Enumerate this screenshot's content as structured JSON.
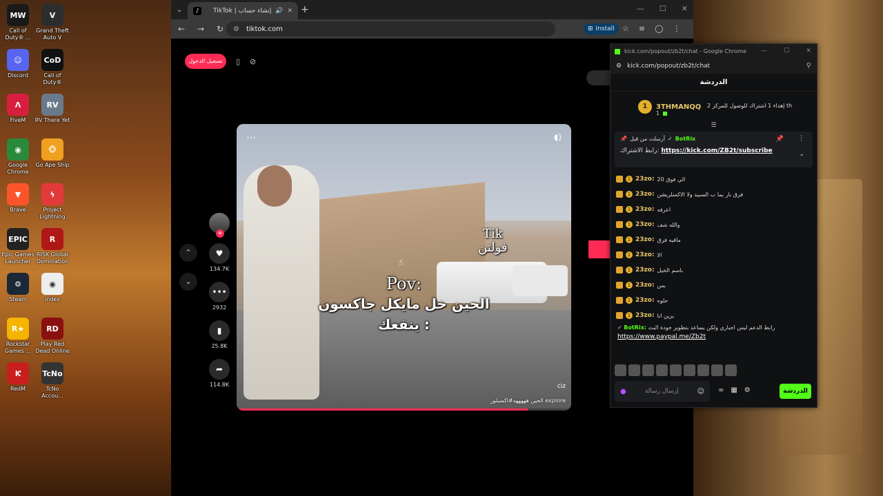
{
  "desktop": {
    "icons": [
      {
        "label": "Call of Duty® ...",
        "icon": "mw-icon",
        "color": "#1a1a1a",
        "glyph": "MW"
      },
      {
        "label": "Grand Theft Auto V",
        "icon": "gta-icon",
        "color": "#2d2d2d",
        "glyph": "V"
      },
      {
        "label": "Discord",
        "icon": "discord-icon",
        "color": "#5865f2",
        "glyph": "☺"
      },
      {
        "label": "Call of Duty®",
        "icon": "cod-icon",
        "color": "#111111",
        "glyph": "CoD"
      },
      {
        "label": "FiveM",
        "icon": "fivem-icon",
        "color": "#d81e3f",
        "glyph": "Λ"
      },
      {
        "label": "RV There Yet",
        "icon": "rv-icon",
        "color": "#6b7a8a",
        "glyph": "RV"
      },
      {
        "label": "Google Chrome",
        "icon": "chrome-icon",
        "color": "#2a8a3a",
        "glyph": "◉"
      },
      {
        "label": "Go Ape Ship",
        "icon": "goape-icon",
        "color": "#f0a020",
        "glyph": "🐵"
      },
      {
        "label": "Brave",
        "icon": "brave-icon",
        "color": "#fb542b",
        "glyph": "▼"
      },
      {
        "label": "Project Lightning",
        "icon": "lightning-icon",
        "color": "#e23a3a",
        "glyph": "ϟ"
      },
      {
        "label": "Epic Games Launcher",
        "icon": "epic-icon",
        "color": "#222222",
        "glyph": "EPIC"
      },
      {
        "label": "RISK Global Domination",
        "icon": "risk-icon",
        "color": "#b01818",
        "glyph": "R"
      },
      {
        "label": "Steam",
        "icon": "steam-icon",
        "color": "#1b2838",
        "glyph": "⚙"
      },
      {
        "label": "index",
        "icon": "index-chrome-icon",
        "color": "#eeeeee",
        "glyph": "◉"
      },
      {
        "label": "Rockstar Games ...",
        "icon": "rockstar-icon",
        "color": "#f4b400",
        "glyph": "R★"
      },
      {
        "label": "Play Red Dead Online",
        "icon": "rdo-icon",
        "color": "#8a1010",
        "glyph": "RD"
      },
      {
        "label": "RedM",
        "icon": "redm-icon",
        "color": "#c81e1e",
        "glyph": "Ƙ"
      },
      {
        "label": "TcNo Accou...",
        "icon": "tcno-icon",
        "color": "#333333",
        "glyph": "TcNo"
      }
    ]
  },
  "browser": {
    "tab_title": "TikTok | إنشاء حساب",
    "tab_favicon": "♪",
    "url": "tiktok.com",
    "install_label": "Install"
  },
  "tiktok": {
    "login_label": "تسجيل الدخول",
    "video": {
      "watermark_tik": "Tik",
      "watermark_name": "فولتن",
      "caption_pov": "Pov:",
      "caption_line1": "الحين خل مايكل جاكسون",
      "caption_line2": "ينفعك :",
      "corner_tag": "ciz",
      "description": "الحين هههههه#اكسبلور explore",
      "progress": 0.87
    },
    "actions": [
      {
        "icon": "heart-icon",
        "glyph": "♥",
        "count": "134.7K"
      },
      {
        "icon": "comment-icon",
        "glyph": "•••",
        "count": "2932"
      },
      {
        "icon": "bookmark-icon",
        "glyph": "▮",
        "count": "25.8K"
      },
      {
        "icon": "share-icon",
        "glyph": "➦",
        "count": "114.8K"
      }
    ]
  },
  "kick": {
    "window_title": "kick.com/popout/zb2t/chat - Google Chrome",
    "url": "kick.com/popout/zb2t/chat",
    "header": "الدردشة",
    "leader": {
      "rank": "1",
      "name": "3THMANQQ",
      "count": "1",
      "goal": "إهداء 1 اشتراك للوصول للمركز 2 th"
    },
    "pinned": {
      "prefix": "أرسلت من قبل",
      "bot_name": "BotRix",
      "label": "رابط الاشتراك:",
      "link": "https://kick.com/ZB2t/subscribe"
    },
    "messages": [
      {
        "user": "23zo:",
        "text": "الي فوق 20"
      },
      {
        "user": "23zo:",
        "text": "فرق بار يما ب السبيد ولا الاكسلريشن"
      },
      {
        "user": "23zo:",
        "text": "اعرفه"
      },
      {
        "user": "23zo:",
        "text": "والله شف"
      },
      {
        "user": "23zo:",
        "text": "ماقيه فرق"
      },
      {
        "user": "23zo:",
        "text": "الا"
      },
      {
        "user": "23zo:",
        "text": "باسم الخيل"
      },
      {
        "user": "23zo:",
        "text": "بس"
      },
      {
        "user": "23zo:",
        "text": "حلوه"
      },
      {
        "user": "23zo:",
        "text": "يزين انا"
      }
    ],
    "bot_message": {
      "name": "BotRix:",
      "text": "رابط الدعم ليس اجباري ولكن يساعد بتطوير جودة البث",
      "link": "https://www.paypal.me/Zb2t"
    },
    "input_placeholder": "إرسال رسالة",
    "send_label": "الدردشة"
  }
}
